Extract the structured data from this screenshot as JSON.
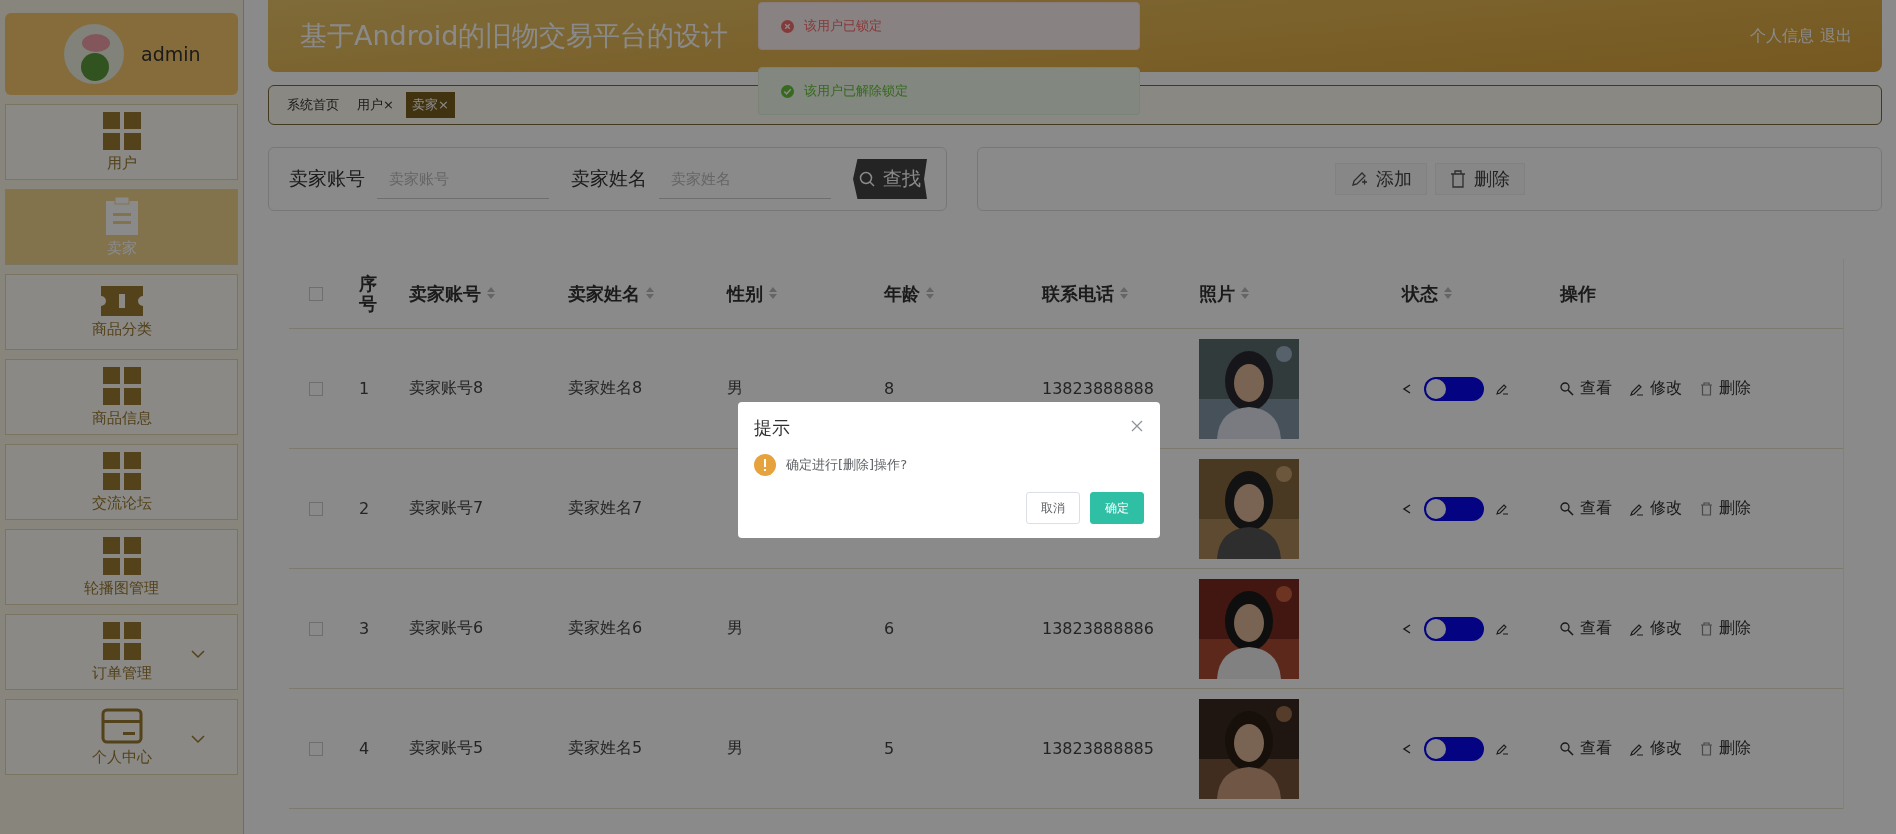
{
  "sidebar": {
    "user": {
      "name": "admin"
    },
    "items": [
      {
        "label": "用户",
        "kind": "grid",
        "selected": false,
        "expandable": false
      },
      {
        "label": "卖家",
        "kind": "clipboard",
        "selected": true,
        "expandable": false
      },
      {
        "label": "商品分类",
        "kind": "ticket",
        "selected": false,
        "expandable": false
      },
      {
        "label": "商品信息",
        "kind": "grid",
        "selected": false,
        "expandable": false
      },
      {
        "label": "交流论坛",
        "kind": "grid",
        "selected": false,
        "expandable": false
      },
      {
        "label": "轮播图管理",
        "kind": "grid",
        "selected": false,
        "expandable": false
      },
      {
        "label": "订单管理",
        "kind": "grid",
        "selected": false,
        "expandable": true
      },
      {
        "label": "个人中心",
        "kind": "card",
        "selected": false,
        "expandable": true
      }
    ]
  },
  "header": {
    "title": "基于Android的旧物交易平台的设计",
    "links": [
      "个人信息",
      "退出"
    ]
  },
  "tabs": [
    {
      "label": "系统首页",
      "selected": false
    },
    {
      "label": "用户",
      "close": "×",
      "selected": false
    },
    {
      "label": "卖家",
      "close": "×",
      "selected": true
    }
  ],
  "search": {
    "fields": [
      {
        "label": "卖家账号",
        "placeholder": "卖家账号"
      },
      {
        "label": "卖家姓名",
        "placeholder": "卖家姓名"
      }
    ],
    "button": "查找"
  },
  "actions": [
    {
      "kind": "add",
      "label": "添加"
    },
    {
      "kind": "delete",
      "label": "删除"
    }
  ],
  "table": {
    "all_checked": false,
    "columns": [
      {
        "label": "序号",
        "sortable": false
      },
      {
        "label": "卖家账号",
        "sortable": true
      },
      {
        "label": "卖家姓名",
        "sortable": true
      },
      {
        "label": "性别",
        "sortable": true
      },
      {
        "label": "年龄",
        "sortable": true
      },
      {
        "label": "联系电话",
        "sortable": true
      },
      {
        "label": "照片",
        "sortable": true
      },
      {
        "label": "状态",
        "sortable": true
      },
      {
        "label": "操作",
        "sortable": false
      }
    ],
    "rows": [
      {
        "checked": false,
        "cells": [
          "1",
          "卖家账号8",
          "卖家姓名8",
          "男",
          "8",
          "13823888888"
        ],
        "photo": {
          "kind": "picture"
        },
        "on": false,
        "actions": [
          "查看",
          "修改",
          "删除"
        ]
      },
      {
        "checked": false,
        "cells": [
          "2",
          "卖家账号7",
          "卖家姓名7"
        ],
        "photo": {
          "kind": "picture"
        },
        "on": false,
        "actions": [
          "查看",
          "修改",
          "删除"
        ]
      },
      {
        "checked": false,
        "cells": [
          "3",
          "卖家账号6",
          "卖家姓名6",
          "男",
          "6",
          "13823888886"
        ],
        "photo": {
          "kind": "picture"
        },
        "on": false,
        "actions": [
          "查看",
          "修改",
          "删除"
        ]
      },
      {
        "checked": false,
        "cells": [
          "4",
          "卖家账号5",
          "卖家姓名5",
          "男",
          "5",
          "13823888885"
        ],
        "photo": {
          "kind": "picture"
        },
        "on": false,
        "actions": [
          "查看",
          "修改",
          "删除"
        ]
      }
    ]
  },
  "toasts": [
    {
      "kind": "error",
      "text": "该用户已锁定"
    },
    {
      "kind": "success",
      "text": "该用户已解除锁定"
    }
  ],
  "dialog": {
    "title": "提示",
    "message": "确定进行[删除]操作?",
    "buttons": [
      {
        "kind": "cancel",
        "label": "取消"
      },
      {
        "kind": "confirm",
        "label": "确定"
      }
    ]
  }
}
